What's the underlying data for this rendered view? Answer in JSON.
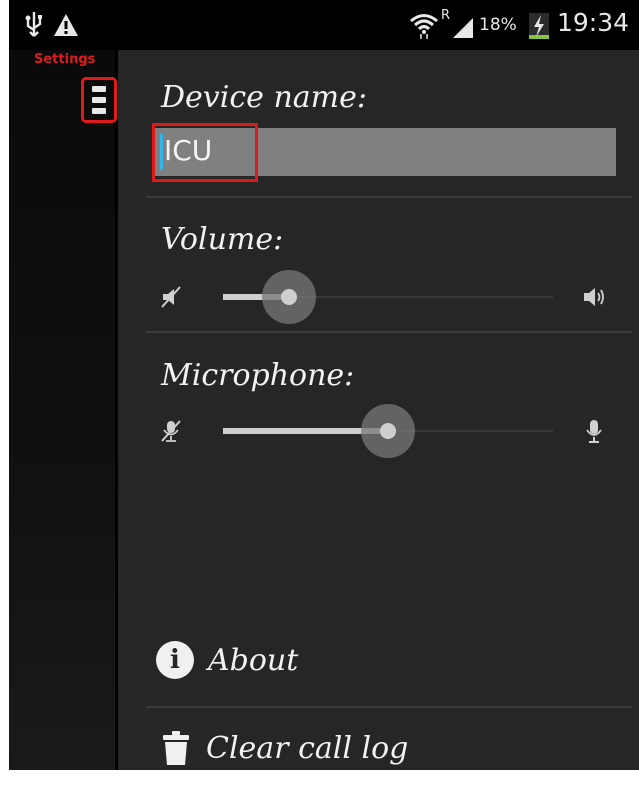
{
  "status_bar": {
    "icons_left": [
      "usb-icon",
      "warning-icon"
    ],
    "icons_right": [
      "wifi-icon",
      "signal-icon",
      "battery-charging-icon"
    ],
    "roaming": "R",
    "battery_percent": "18%",
    "time": "19:34"
  },
  "drawer": {
    "label": "Settings",
    "menu_icon": "menu-icon"
  },
  "settings": {
    "device_name_label": "Device name:",
    "device_name_value": "ICU",
    "volume_label": "Volume:",
    "volume_level": 0.2,
    "volume_icons": [
      "mute-icon",
      "speaker-icon"
    ],
    "microphone_label": "Microphone:",
    "microphone_level": 0.5,
    "microphone_icons": [
      "mic-off-icon",
      "mic-icon"
    ]
  },
  "actions": {
    "about_label": "About",
    "about_icon": "info-icon",
    "clear_label": "Clear call log",
    "clear_icon": "trash-icon"
  },
  "colors": {
    "panel_bg": "#262626",
    "accent_cursor": "#33b5e5",
    "highlight_red": "#e01a1a"
  }
}
